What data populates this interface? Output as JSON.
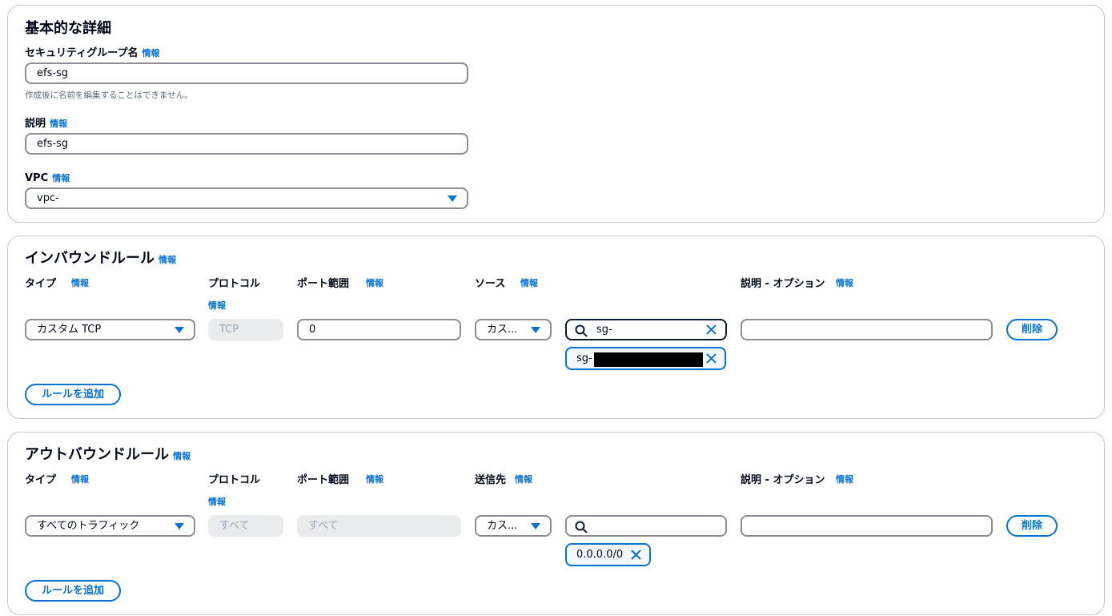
{
  "basic": {
    "title": "基本的な詳細",
    "name_label": "セキュリティグループ名",
    "info": "情報",
    "name_value": "efs-sg",
    "name_hint": "作成後に名前を編集することはできません。",
    "desc_label": "説明",
    "desc_value": "efs-sg",
    "vpc_label": "VPC",
    "vpc_value": "vpc-"
  },
  "inbound": {
    "title": "インバウンドルール",
    "info": "情報",
    "col_type": "タイプ",
    "col_protocol": "プロトコル",
    "col_port": "ポート範囲",
    "col_source": "ソース",
    "col_desc": "説明 - オプション",
    "type_value": "カスタム TCP",
    "protocol_value": "TCP",
    "port_value": "0",
    "source_select": "カス...",
    "search_value": "sg-",
    "token_label": "sg-",
    "delete_label": "削除",
    "add_rule_label": "ルールを追加"
  },
  "outbound": {
    "title": "アウトバウンドルール",
    "info": "情報",
    "col_type": "タイプ",
    "col_protocol": "プロトコル",
    "col_port": "ポート範囲",
    "col_dest": "送信先",
    "col_desc": "説明 - オプション",
    "type_value": "すべてのトラフィック",
    "protocol_value": "すべて",
    "port_value": "すべて",
    "dest_select": "カス...",
    "search_value": "",
    "token_label": "0.0.0.0/0",
    "delete_label": "削除",
    "add_rule_label": "ルールを追加"
  },
  "colors": {
    "accent": "#0972d3",
    "text": "#000716",
    "border": "#8c8c94",
    "disabled_bg": "#e9ebed"
  },
  "icons": [
    "caret-down-icon",
    "search-icon",
    "close-icon"
  ]
}
